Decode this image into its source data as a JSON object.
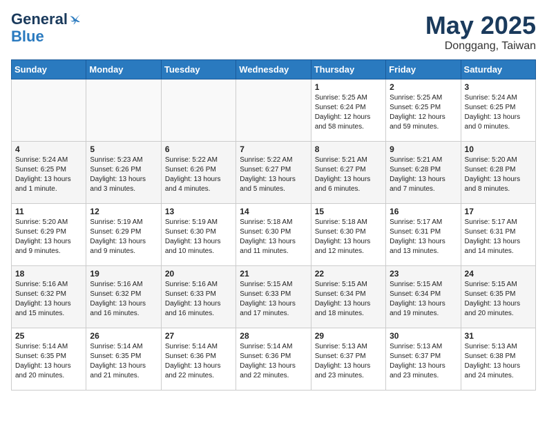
{
  "logo": {
    "line1": "General",
    "line2": "Blue"
  },
  "title": "May 2025",
  "location": "Donggang, Taiwan",
  "days_of_week": [
    "Sunday",
    "Monday",
    "Tuesday",
    "Wednesday",
    "Thursday",
    "Friday",
    "Saturday"
  ],
  "weeks": [
    [
      {
        "day": "",
        "info": ""
      },
      {
        "day": "",
        "info": ""
      },
      {
        "day": "",
        "info": ""
      },
      {
        "day": "",
        "info": ""
      },
      {
        "day": "1",
        "info": "Sunrise: 5:25 AM\nSunset: 6:24 PM\nDaylight: 12 hours\nand 58 minutes."
      },
      {
        "day": "2",
        "info": "Sunrise: 5:25 AM\nSunset: 6:25 PM\nDaylight: 12 hours\nand 59 minutes."
      },
      {
        "day": "3",
        "info": "Sunrise: 5:24 AM\nSunset: 6:25 PM\nDaylight: 13 hours\nand 0 minutes."
      }
    ],
    [
      {
        "day": "4",
        "info": "Sunrise: 5:24 AM\nSunset: 6:25 PM\nDaylight: 13 hours\nand 1 minute."
      },
      {
        "day": "5",
        "info": "Sunrise: 5:23 AM\nSunset: 6:26 PM\nDaylight: 13 hours\nand 3 minutes."
      },
      {
        "day": "6",
        "info": "Sunrise: 5:22 AM\nSunset: 6:26 PM\nDaylight: 13 hours\nand 4 minutes."
      },
      {
        "day": "7",
        "info": "Sunrise: 5:22 AM\nSunset: 6:27 PM\nDaylight: 13 hours\nand 5 minutes."
      },
      {
        "day": "8",
        "info": "Sunrise: 5:21 AM\nSunset: 6:27 PM\nDaylight: 13 hours\nand 6 minutes."
      },
      {
        "day": "9",
        "info": "Sunrise: 5:21 AM\nSunset: 6:28 PM\nDaylight: 13 hours\nand 7 minutes."
      },
      {
        "day": "10",
        "info": "Sunrise: 5:20 AM\nSunset: 6:28 PM\nDaylight: 13 hours\nand 8 minutes."
      }
    ],
    [
      {
        "day": "11",
        "info": "Sunrise: 5:20 AM\nSunset: 6:29 PM\nDaylight: 13 hours\nand 9 minutes."
      },
      {
        "day": "12",
        "info": "Sunrise: 5:19 AM\nSunset: 6:29 PM\nDaylight: 13 hours\nand 9 minutes."
      },
      {
        "day": "13",
        "info": "Sunrise: 5:19 AM\nSunset: 6:30 PM\nDaylight: 13 hours\nand 10 minutes."
      },
      {
        "day": "14",
        "info": "Sunrise: 5:18 AM\nSunset: 6:30 PM\nDaylight: 13 hours\nand 11 minutes."
      },
      {
        "day": "15",
        "info": "Sunrise: 5:18 AM\nSunset: 6:30 PM\nDaylight: 13 hours\nand 12 minutes."
      },
      {
        "day": "16",
        "info": "Sunrise: 5:17 AM\nSunset: 6:31 PM\nDaylight: 13 hours\nand 13 minutes."
      },
      {
        "day": "17",
        "info": "Sunrise: 5:17 AM\nSunset: 6:31 PM\nDaylight: 13 hours\nand 14 minutes."
      }
    ],
    [
      {
        "day": "18",
        "info": "Sunrise: 5:16 AM\nSunset: 6:32 PM\nDaylight: 13 hours\nand 15 minutes."
      },
      {
        "day": "19",
        "info": "Sunrise: 5:16 AM\nSunset: 6:32 PM\nDaylight: 13 hours\nand 16 minutes."
      },
      {
        "day": "20",
        "info": "Sunrise: 5:16 AM\nSunset: 6:33 PM\nDaylight: 13 hours\nand 16 minutes."
      },
      {
        "day": "21",
        "info": "Sunrise: 5:15 AM\nSunset: 6:33 PM\nDaylight: 13 hours\nand 17 minutes."
      },
      {
        "day": "22",
        "info": "Sunrise: 5:15 AM\nSunset: 6:34 PM\nDaylight: 13 hours\nand 18 minutes."
      },
      {
        "day": "23",
        "info": "Sunrise: 5:15 AM\nSunset: 6:34 PM\nDaylight: 13 hours\nand 19 minutes."
      },
      {
        "day": "24",
        "info": "Sunrise: 5:15 AM\nSunset: 6:35 PM\nDaylight: 13 hours\nand 20 minutes."
      }
    ],
    [
      {
        "day": "25",
        "info": "Sunrise: 5:14 AM\nSunset: 6:35 PM\nDaylight: 13 hours\nand 20 minutes."
      },
      {
        "day": "26",
        "info": "Sunrise: 5:14 AM\nSunset: 6:35 PM\nDaylight: 13 hours\nand 21 minutes."
      },
      {
        "day": "27",
        "info": "Sunrise: 5:14 AM\nSunset: 6:36 PM\nDaylight: 13 hours\nand 22 minutes."
      },
      {
        "day": "28",
        "info": "Sunrise: 5:14 AM\nSunset: 6:36 PM\nDaylight: 13 hours\nand 22 minutes."
      },
      {
        "day": "29",
        "info": "Sunrise: 5:13 AM\nSunset: 6:37 PM\nDaylight: 13 hours\nand 23 minutes."
      },
      {
        "day": "30",
        "info": "Sunrise: 5:13 AM\nSunset: 6:37 PM\nDaylight: 13 hours\nand 23 minutes."
      },
      {
        "day": "31",
        "info": "Sunrise: 5:13 AM\nSunset: 6:38 PM\nDaylight: 13 hours\nand 24 minutes."
      }
    ]
  ]
}
